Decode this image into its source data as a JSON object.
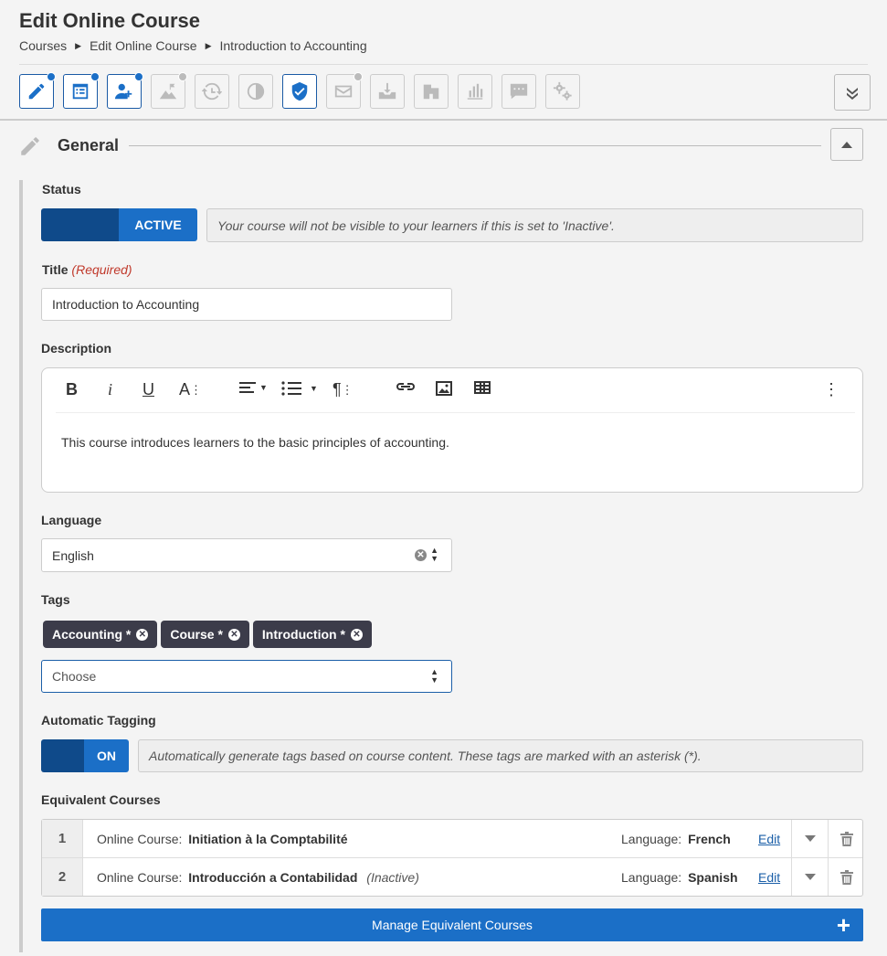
{
  "header": {
    "title": "Edit Online Course",
    "breadcrumbs": [
      "Courses",
      "Edit Online Course",
      "Introduction to Accounting"
    ]
  },
  "toolbar": {
    "buttons": [
      {
        "icon": "pencil-icon",
        "active": true,
        "dot": "blue"
      },
      {
        "icon": "list-icon",
        "active": true,
        "dot": "blue"
      },
      {
        "icon": "add-user-icon",
        "active": true,
        "dot": "blue"
      },
      {
        "icon": "mountain-flag-icon",
        "active": false,
        "dot": "grey"
      },
      {
        "icon": "refresh-clock-icon",
        "active": false,
        "dot": ""
      },
      {
        "icon": "contrast-icon",
        "active": false,
        "dot": ""
      },
      {
        "icon": "shield-check-icon",
        "active": true,
        "dot": ""
      },
      {
        "icon": "envelope-icon",
        "active": false,
        "dot": "grey"
      },
      {
        "icon": "inbox-download-icon",
        "active": false,
        "dot": ""
      },
      {
        "icon": "building-icon",
        "active": false,
        "dot": ""
      },
      {
        "icon": "bar-chart-icon",
        "active": false,
        "dot": ""
      },
      {
        "icon": "comment-icon",
        "active": false,
        "dot": ""
      },
      {
        "icon": "gears-icon",
        "active": false,
        "dot": ""
      }
    ],
    "expand_icon": "double-chevron-down-icon"
  },
  "section": {
    "title": "General",
    "icon": "pencil-icon"
  },
  "status": {
    "label": "Status",
    "toggle_text": "ACTIVE",
    "note": "Your course will not be visible to your learners if this is set to 'Inactive'."
  },
  "title_field": {
    "label": "Title",
    "required": "(Required)",
    "value": "Introduction to Accounting"
  },
  "description": {
    "label": "Description",
    "text": "This course introduces learners to the basic principles of accounting."
  },
  "language": {
    "label": "Language",
    "value": "English"
  },
  "tags": {
    "label": "Tags",
    "items": [
      "Accounting *",
      "Course *",
      "Introduction *"
    ],
    "placeholder": "Choose"
  },
  "auto_tagging": {
    "label": "Automatic Tagging",
    "toggle_text": "ON",
    "note": "Automatically generate tags based on course content. These tags are marked with an asterisk (*)."
  },
  "equivalent": {
    "label": "Equivalent Courses",
    "rows": [
      {
        "num": "1",
        "prefix": "Online Course:",
        "name": "Initiation à la Comptabilité",
        "status": "",
        "lang_prefix": "Language:",
        "lang": "French",
        "edit": "Edit"
      },
      {
        "num": "2",
        "prefix": "Online Course:",
        "name": "Introducción a Contabilidad",
        "status": "(Inactive)",
        "lang_prefix": "Language:",
        "lang": "Spanish",
        "edit": "Edit"
      }
    ],
    "manage_button": "Manage Equivalent Courses"
  },
  "colors": {
    "accent": "#1b6fc7",
    "accent_dark": "#0f4a8a",
    "tag_bg": "#3c3c4a",
    "required": "#c0392b"
  }
}
